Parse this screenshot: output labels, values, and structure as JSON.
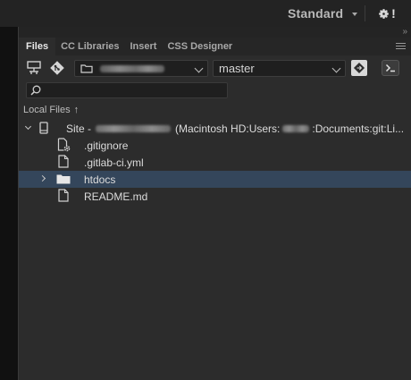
{
  "topbar": {
    "workspace_label": "Standard",
    "warning_mark": "!"
  },
  "tabs": [
    {
      "label": "Files",
      "active": true
    },
    {
      "label": "CC Libraries",
      "active": false
    },
    {
      "label": "Insert",
      "active": false
    },
    {
      "label": "CSS Designer",
      "active": false
    }
  ],
  "toolbar": {
    "branch": "master"
  },
  "local_files": {
    "header": "Local Files",
    "site": {
      "prefix": "Site - ",
      "path_start": "(Macintosh HD:Users:",
      "path_end": ":Documents:git:Li..."
    },
    "items": [
      {
        "name": ".gitignore",
        "icon": "settings-file-icon"
      },
      {
        "name": ".gitlab-ci.yml",
        "icon": "file-icon"
      },
      {
        "name": "htdocs",
        "icon": "folder-icon",
        "selected": true
      },
      {
        "name": "README.md",
        "icon": "file-icon"
      }
    ]
  },
  "colors": {
    "selection": "#34465b",
    "panel_bg": "#2c2c2c"
  }
}
